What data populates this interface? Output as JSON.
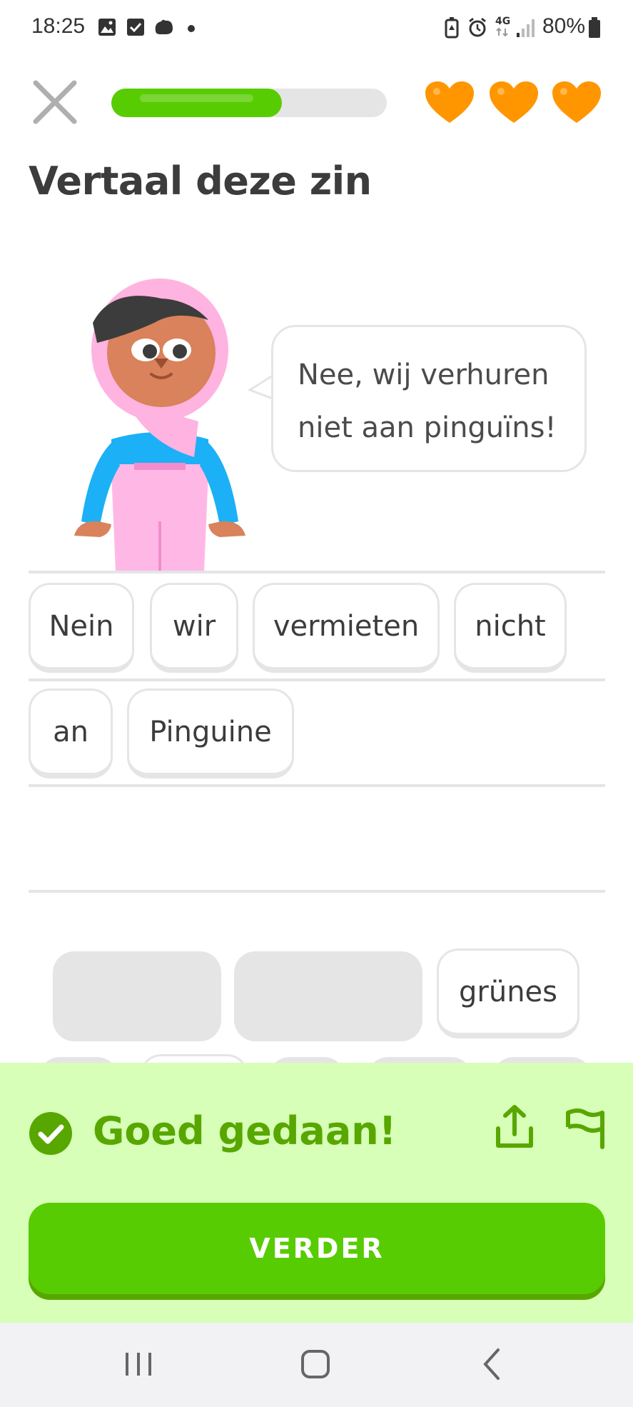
{
  "status_bar": {
    "time": "18:25",
    "battery": "80%",
    "network": "4G"
  },
  "header": {
    "progress_fraction": 0.62,
    "hearts": 3,
    "heart_color": "#ff9600"
  },
  "title": "Vertaal deze zin",
  "prompt": {
    "line1": "Nee, wij verhuren",
    "line2": "niet aan pinguïns!"
  },
  "answer_words": [
    "Nein",
    "wir",
    "vermieten",
    "nicht",
    "an",
    "Pinguine"
  ],
  "word_bank": {
    "visible_word": "grünes"
  },
  "feedback": {
    "message": "Goed gedaan!",
    "continue_label": "VERDER",
    "color": "#58cc02"
  },
  "icons": {
    "close": "close-icon",
    "heart": "heart-icon",
    "check": "check-circle-icon",
    "share": "share-icon",
    "report": "flag-icon",
    "nav_recent": "recent-apps-icon",
    "nav_home": "home-icon",
    "nav_back": "back-icon"
  }
}
